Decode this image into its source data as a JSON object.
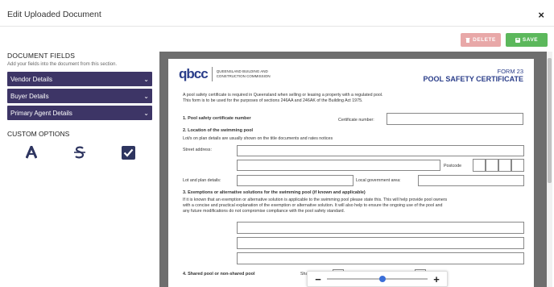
{
  "underlay": {
    "text": "Edit Uploaded Document"
  },
  "modal": {
    "title": "Edit Uploaded Document",
    "close": "×"
  },
  "toolbar": {
    "delete_label": "DELETE",
    "save_label": "SAVE"
  },
  "sidebar": {
    "heading": "DOCUMENT FIELDS",
    "subtitle": "Add your fields into the document from this section.",
    "sections": [
      {
        "label": "Vendor Details"
      },
      {
        "label": "Buyer Details"
      },
      {
        "label": "Primary Agent Details"
      }
    ],
    "custom_heading": "CUSTOM OPTIONS"
  },
  "doc": {
    "logo_text": "qbcc",
    "org_line1": "QUEENSLAND BUILDING AND",
    "org_line2": "CONSTRUCTION COMMISSION",
    "form_no": "FORM 23",
    "form_title": "POOL SAFETY CERTIFICATE",
    "intro1": "A pool safety certificate is required in Queensland when selling or leasing a property with a regulated pool.",
    "intro2": "This form is to be used for the purposes of sections 246AA and 246AK of the Building Act 1975.",
    "s1": "1. Pool safety certificate number",
    "cert_label": "Certificate number:",
    "s2": "2. Location of the swimming pool",
    "s2_note": "Lot/s on plan details are usually shown on the title documents and rates notices",
    "street": "Street address:",
    "postcode": "Postcode",
    "lot": "Lot and plan details:",
    "lga": "Local government area:",
    "s3": "3. Exemptions or alternative solutions for the swimming pool (if known and applicable)",
    "s3_note1": "If it is known that an exemption or alternative solution is applicable to the swimming pool please state this. This will help provide pool owners",
    "s3_note2": "with a concise and practical explanation of the exemption or alternative solution. It will also help to ensure the ongoing use of the pool and",
    "s3_note3": "any future modifications do not compromise compliance with the pool safety standard.",
    "s4": "4. Shared pool or non-shared pool",
    "s4_tail": "Shar"
  },
  "zoom": {
    "minus": "−",
    "plus": "+",
    "level": 0.55
  },
  "colors": {
    "sidebar_accent": "#3d3566",
    "save": "#5cb85c",
    "delete": "#e8a8a8",
    "brand": "#2b3e8a"
  }
}
